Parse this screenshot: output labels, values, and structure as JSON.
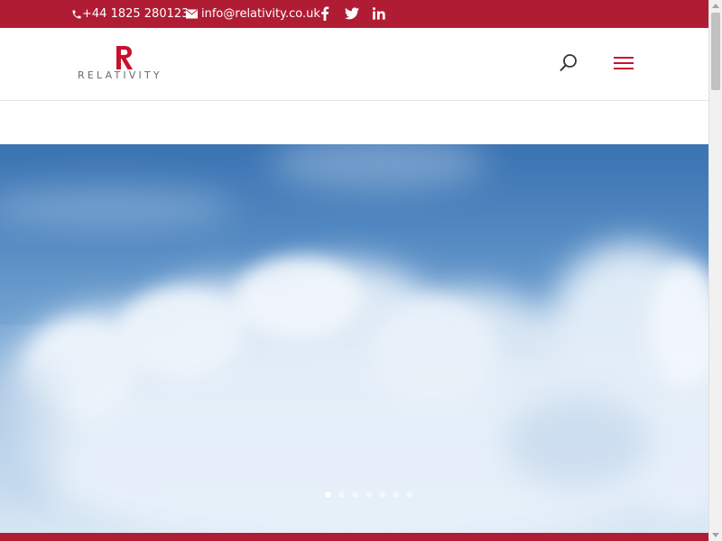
{
  "topbar": {
    "phone": "+44 1825 280123",
    "email": "info@relativity.co.uk",
    "social": [
      "facebook-icon",
      "twitter-icon",
      "linkedin-icon"
    ],
    "background": "#b01c34"
  },
  "header": {
    "logo_text": "RELATIVITY",
    "icons": [
      "search-icon",
      "hamburger-menu-icon"
    ],
    "accent": "#c8102e"
  },
  "hero": {
    "slides_visible_dots": 1
  }
}
